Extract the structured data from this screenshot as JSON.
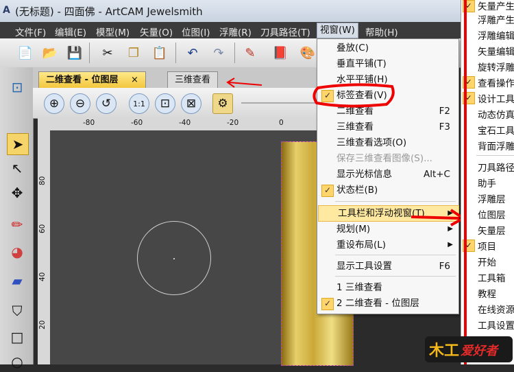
{
  "window": {
    "app_glyph": "A",
    "title": "(无标题) - 四面佛 - ArtCAM Jewelsmith"
  },
  "menubar": {
    "items": [
      "文件(F)",
      "编辑(E)",
      "模型(M)",
      "矢量(O)",
      "位图(I)",
      "浮雕(R)",
      "刀具路径(T)",
      "视窗(W)",
      "帮助(H)"
    ],
    "active": "视窗(W)"
  },
  "toolbar": {
    "icons": [
      "new-file-icon",
      "open-folder-icon",
      "save-icon",
      "cut-icon",
      "copy-icon",
      "paste-icon",
      "undo-icon",
      "redo-icon",
      "edit-pen-icon",
      "book-icon",
      "paint-icon"
    ]
  },
  "tabs": [
    {
      "label": "二维查看 - 位图层",
      "close": "×",
      "active": true
    },
    {
      "label": "三维查看",
      "active": false
    }
  ],
  "viewtoolbar": {
    "icons": [
      "zoom-in-icon",
      "zoom-out-icon",
      "zoom-previous-icon",
      "zoom-1to1-icon",
      "zoom-fit-icon",
      "zoom-all-icon",
      "render-icon"
    ]
  },
  "ruler": {
    "top": [
      "-80",
      "-60",
      "-40",
      "-20",
      "0"
    ],
    "left": [
      "80",
      "60",
      "40",
      "20"
    ]
  },
  "dropdown": {
    "items": [
      {
        "label": "叠放(C)",
        "shortcut": "",
        "checked": false,
        "disabled": false,
        "submenu": false
      },
      {
        "label": "垂直平铺(T)",
        "shortcut": "",
        "checked": false,
        "disabled": false,
        "submenu": false
      },
      {
        "label": "水平平铺(H)",
        "shortcut": "",
        "checked": false,
        "disabled": false,
        "submenu": false
      },
      {
        "label": "标签查看(V)",
        "shortcut": "",
        "checked": true,
        "disabled": false,
        "submenu": false
      },
      {
        "label": "二维查看",
        "shortcut": "F2",
        "checked": false,
        "disabled": false,
        "submenu": false
      },
      {
        "label": "三维查看",
        "shortcut": "F3",
        "checked": false,
        "disabled": false,
        "submenu": false
      },
      {
        "label": "三维查看选项(O)",
        "shortcut": "",
        "checked": false,
        "disabled": false,
        "submenu": false
      },
      {
        "label": "保存三维查看图像(S)...",
        "shortcut": "",
        "checked": false,
        "disabled": true,
        "submenu": false
      },
      {
        "label": "显示光标信息",
        "shortcut": "Alt+C",
        "checked": false,
        "disabled": false,
        "submenu": false
      },
      {
        "label": "状态栏(B)",
        "shortcut": "",
        "checked": true,
        "disabled": false,
        "submenu": false
      },
      {
        "label": "工具栏和浮动视窗(T)",
        "shortcut": "",
        "checked": false,
        "disabled": false,
        "submenu": true,
        "highlighted": true
      },
      {
        "label": "规划(M)",
        "shortcut": "",
        "checked": false,
        "disabled": false,
        "submenu": true
      },
      {
        "label": "重设布局(L)",
        "shortcut": "",
        "checked": false,
        "disabled": false,
        "submenu": true
      },
      {
        "label": "显示工具设置",
        "shortcut": "F6",
        "checked": false,
        "disabled": false,
        "submenu": false
      },
      {
        "label": "1 三维查看",
        "shortcut": "",
        "checked": false,
        "disabled": false,
        "submenu": false
      },
      {
        "label": "2 二维查看 - 位图层",
        "shortcut": "",
        "checked": true,
        "disabled": false,
        "submenu": false
      }
    ]
  },
  "rightpanel": {
    "items": [
      {
        "label": "矢量产生",
        "checked": true
      },
      {
        "label": "浮雕产生",
        "checked": false
      },
      {
        "label": "浮雕编辑",
        "checked": false
      },
      {
        "label": "矢量编辑",
        "checked": false
      },
      {
        "label": "旋转浮雕",
        "checked": false
      },
      {
        "label": "查看操作",
        "checked": true
      },
      {
        "label": "设计工具",
        "checked": true
      },
      {
        "label": "动态仿真",
        "checked": false
      },
      {
        "label": "宝石工具",
        "checked": false
      },
      {
        "label": "背面浮雕",
        "checked": false
      },
      {
        "label": "刀具路径",
        "checked": false
      },
      {
        "label": "助手",
        "checked": false
      },
      {
        "label": "浮雕层",
        "checked": false
      },
      {
        "label": "位图层",
        "checked": false
      },
      {
        "label": "矢量层",
        "checked": false
      },
      {
        "label": "项目",
        "checked": true
      },
      {
        "label": "开始",
        "checked": false
      },
      {
        "label": "工具箱",
        "checked": false
      },
      {
        "label": "教程",
        "checked": false
      },
      {
        "label": "在线资源",
        "checked": false
      },
      {
        "label": "工具设置",
        "checked": false
      }
    ]
  },
  "colors": {
    "annotation": "#e00000",
    "menu_highlight": "#ffe9a0",
    "check_bg": "#ffd46a",
    "active_tab": "#f2c53a"
  }
}
